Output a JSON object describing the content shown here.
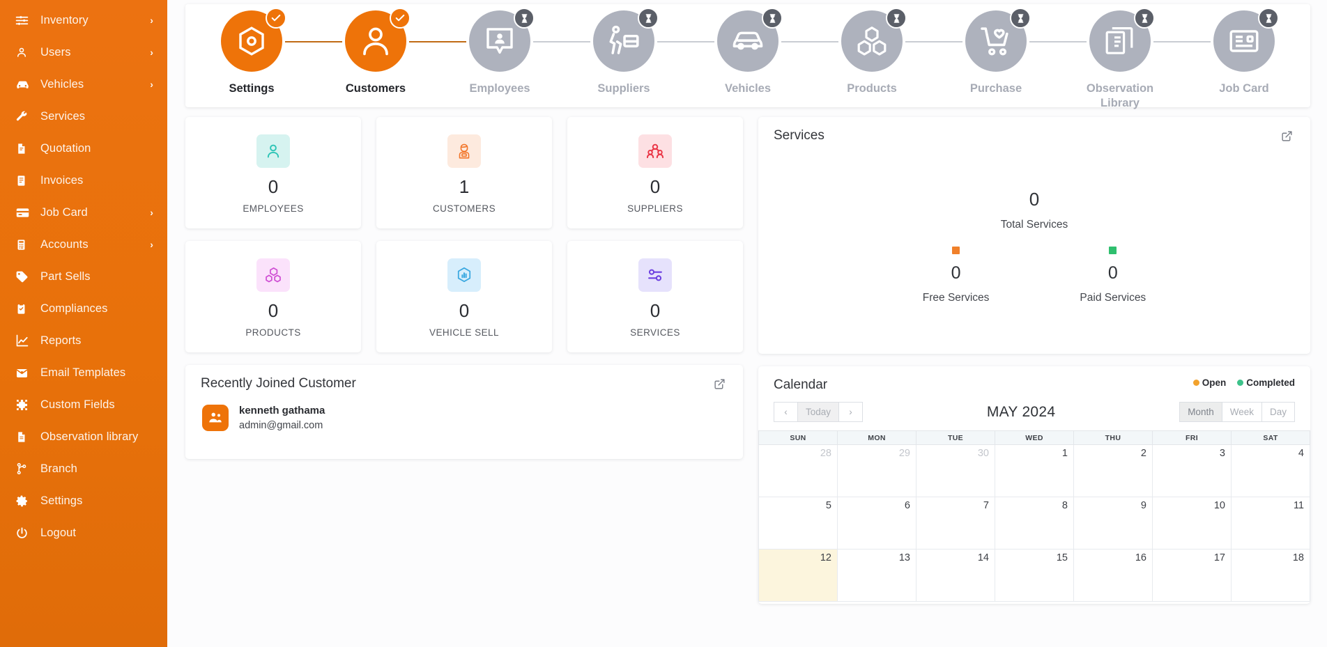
{
  "sidebar": {
    "items": [
      {
        "label": "Inventory",
        "icon": "sliders-icon",
        "caret": "›"
      },
      {
        "label": "Users",
        "icon": "user-icon",
        "caret": "›"
      },
      {
        "label": "Vehicles",
        "icon": "car-icon",
        "caret": "›"
      },
      {
        "label": "Services",
        "icon": "wrench-icon",
        "caret": ""
      },
      {
        "label": "Quotation",
        "icon": "quote-doc-icon",
        "caret": ""
      },
      {
        "label": "Invoices",
        "icon": "invoice-icon",
        "caret": ""
      },
      {
        "label": "Job Card",
        "icon": "card-icon",
        "caret": "›"
      },
      {
        "label": "Accounts",
        "icon": "calculator-icon",
        "caret": "›"
      },
      {
        "label": "Part Sells",
        "icon": "tag-icon",
        "caret": ""
      },
      {
        "label": "Compliances",
        "icon": "clipboard-icon",
        "caret": ""
      },
      {
        "label": "Reports",
        "icon": "chart-line-icon",
        "caret": ""
      },
      {
        "label": "Email Templates",
        "icon": "envelope-icon",
        "caret": ""
      },
      {
        "label": "Custom Fields",
        "icon": "puzzle-icon",
        "caret": ""
      },
      {
        "label": "Observation library",
        "icon": "document-icon",
        "caret": ""
      },
      {
        "label": "Branch",
        "icon": "branch-icon",
        "caret": ""
      },
      {
        "label": "Settings",
        "icon": "gear-icon",
        "caret": ""
      },
      {
        "label": "Logout",
        "icon": "power-icon",
        "caret": ""
      }
    ]
  },
  "stepper": {
    "steps": [
      {
        "label": "Settings",
        "icon": "hex-gear-icon",
        "state": "done",
        "badge": "check-badge-icon"
      },
      {
        "label": "Customers",
        "icon": "person-icon",
        "state": "done",
        "badge": "check-badge-icon"
      },
      {
        "label": "Employees",
        "icon": "id-badge-icon",
        "state": "pending",
        "badge": "hourglass-badge-icon"
      },
      {
        "label": "Suppliers",
        "icon": "delivery-icon",
        "state": "pending",
        "badge": "hourglass-badge-icon"
      },
      {
        "label": "Vehicles",
        "icon": "car-side-icon",
        "state": "pending",
        "badge": "hourglass-badge-icon"
      },
      {
        "label": "Products",
        "icon": "boxes-icon",
        "state": "pending",
        "badge": "hourglass-badge-icon"
      },
      {
        "label": "Purchase",
        "icon": "cart-heart-icon",
        "state": "pending",
        "badge": "hourglass-badge-icon"
      },
      {
        "label": "Observation Library",
        "icon": "library-icon",
        "state": "pending",
        "badge": "hourglass-badge-icon"
      },
      {
        "label": "Job Card",
        "icon": "jobcard-icon",
        "state": "pending",
        "badge": "hourglass-badge-icon"
      }
    ]
  },
  "tiles": [
    {
      "value": "0",
      "label": "EMPLOYEES",
      "icon": "employee-icon",
      "icon_bg": "#d6f3f0",
      "icon_color": "#2ec4b6"
    },
    {
      "value": "1",
      "label": "CUSTOMERS",
      "icon": "customer-icon",
      "icon_bg": "#fdeade",
      "icon_color": "#f2762a"
    },
    {
      "value": "0",
      "label": "SUPPLIERS",
      "icon": "supplier-icon",
      "icon_bg": "#fde0e3",
      "icon_color": "#ea3546"
    },
    {
      "value": "0",
      "label": "PRODUCTS",
      "icon": "product-icon",
      "icon_bg": "#fbe2fb",
      "icon_color": "#cf4fd4"
    },
    {
      "value": "0",
      "label": "VEHICLE SELL",
      "icon": "vehicle-sell-icon",
      "icon_bg": "#d7eefc",
      "icon_color": "#3aa8e0"
    },
    {
      "value": "0",
      "label": "SERVICES",
      "icon": "service-icon",
      "icon_bg": "#e6e2fc",
      "icon_color": "#6c3fe0"
    }
  ],
  "services": {
    "title": "Services",
    "link_icon": "external-link-icon",
    "total_value": "0",
    "total_label": "Total Services",
    "free_value": "0",
    "free_label": "Free Services",
    "free_color": "#f0802a",
    "paid_value": "0",
    "paid_label": "Paid Services",
    "paid_color": "#2fbf6e"
  },
  "recent": {
    "title": "Recently Joined Customer",
    "link_icon": "external-link-icon",
    "customer": {
      "name": "kenneth gathama",
      "email": "admin@gmail.com",
      "avatar_icon": "customer-group-icon"
    }
  },
  "calendar": {
    "title": "Calendar",
    "legend": [
      {
        "label": "Open",
        "color": "#f2a22d"
      },
      {
        "label": "Completed",
        "color": "#3dc28a"
      }
    ],
    "nav": {
      "prev": "‹",
      "today": "Today",
      "next": "›"
    },
    "month_title": "MAY 2024",
    "views": [
      {
        "label": "Month",
        "active": true
      },
      {
        "label": "Week",
        "active": false
      },
      {
        "label": "Day",
        "active": false
      }
    ],
    "day_headers": [
      "SUN",
      "MON",
      "TUE",
      "WED",
      "THU",
      "FRI",
      "SAT"
    ],
    "weeks": [
      [
        {
          "d": "28",
          "other": true
        },
        {
          "d": "29",
          "other": true
        },
        {
          "d": "30",
          "other": true
        },
        {
          "d": "1"
        },
        {
          "d": "2"
        },
        {
          "d": "3"
        },
        {
          "d": "4"
        }
      ],
      [
        {
          "d": "5"
        },
        {
          "d": "6"
        },
        {
          "d": "7"
        },
        {
          "d": "8"
        },
        {
          "d": "9"
        },
        {
          "d": "10"
        },
        {
          "d": "11"
        }
      ],
      [
        {
          "d": "12",
          "today": true
        },
        {
          "d": "13"
        },
        {
          "d": "14"
        },
        {
          "d": "15"
        },
        {
          "d": "16"
        },
        {
          "d": "17"
        },
        {
          "d": "18"
        }
      ]
    ]
  },
  "colors": {
    "brand_orange": "#ee7309",
    "sidebar_orange": "#e8710a",
    "pending_gray": "#aeb2bd",
    "page_bg": "#fcfcfd"
  }
}
